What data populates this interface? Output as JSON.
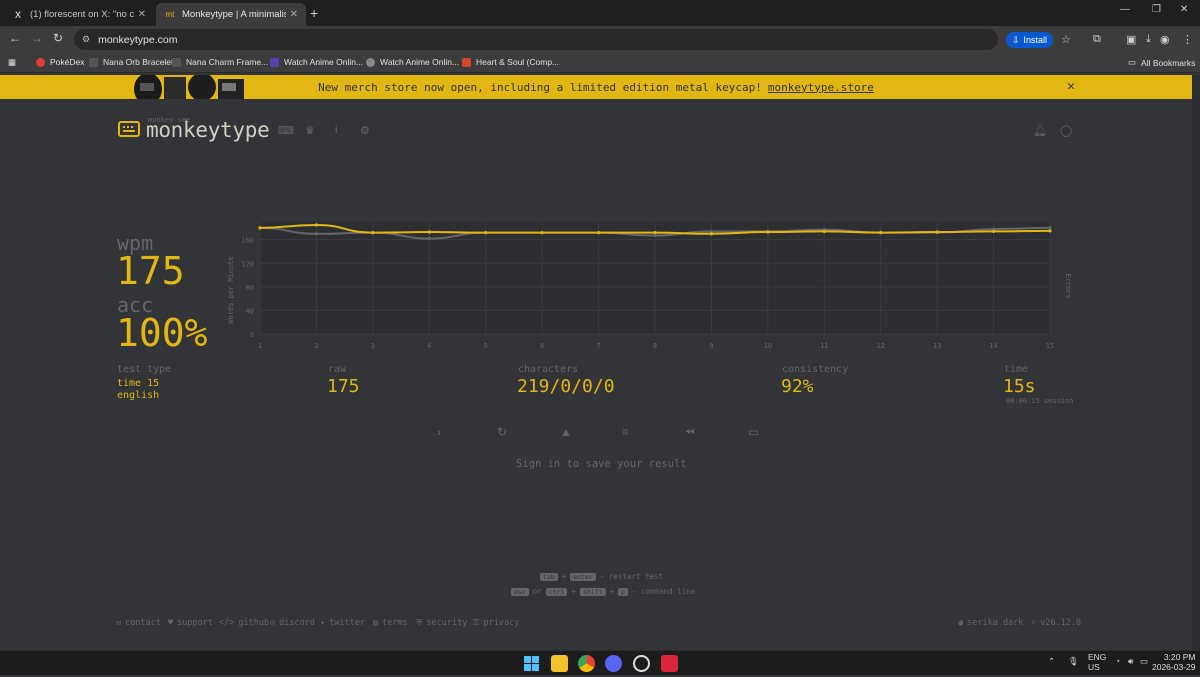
{
  "browser": {
    "tabs": [
      {
        "title": "(1) florescent on X: \"no caption",
        "favicon": "X"
      },
      {
        "title": "Monkeytype | A minimalistic, cu",
        "favicon": "mt"
      }
    ],
    "url": "monkeytype.com",
    "install_label": "Install",
    "bookmarks": [
      "PokéDex",
      "Nana Orb Bracelet",
      "Nana Charm Frame...",
      "Watch Anime Onlin...",
      "Watch Anime Onlin...",
      "Heart & Soul (Comp..."
    ],
    "all_bookmarks": "All Bookmarks"
  },
  "banner": {
    "text": "New merch store now open, including a limited edition metal keycap!",
    "link": "monkeytype.store",
    "close": "✕"
  },
  "header": {
    "logo_sub": "monkey see",
    "logo_text": "monkeytype"
  },
  "result": {
    "wpm_label": "wpm",
    "wpm": "175",
    "acc_label": "acc",
    "acc": "100%",
    "test_type_label": "test type",
    "test_type_mode": "time 15",
    "test_type_lang": "english",
    "raw_label": "raw",
    "raw": "175",
    "characters_label": "characters",
    "characters": "219/0/0/0",
    "consistency_label": "consistency",
    "consistency": "92%",
    "time_label": "time",
    "time": "15s",
    "session": "00:00:15 session"
  },
  "chart_data": {
    "type": "line",
    "x": [
      1,
      2,
      3,
      4,
      5,
      6,
      7,
      8,
      9,
      10,
      11,
      12,
      13,
      14,
      15
    ],
    "series": [
      {
        "name": "wpm",
        "color": "#e2b714",
        "values": [
          180,
          185,
          172,
          173,
          172,
          172,
          172,
          172,
          170,
          173,
          174,
          172,
          173,
          174,
          175
        ]
      },
      {
        "name": "raw",
        "color": "#646669",
        "values": [
          180,
          170,
          172,
          162,
          172,
          172,
          172,
          167,
          174,
          174,
          177,
          172,
          172,
          178,
          180
        ]
      }
    ],
    "ylabel": "Words per Minute",
    "y2label": "Errors",
    "yticks": [
      0,
      40,
      80,
      120,
      160
    ],
    "ylim": [
      0,
      190
    ]
  },
  "actions": {
    "hint": "Sign in to save your result"
  },
  "hints": {
    "restart_keys": [
      "tab",
      "enter"
    ],
    "restart_text": "- restart test",
    "cmd_keys": [
      "esc",
      "ctrl",
      "shift",
      "p"
    ],
    "or": "or",
    "cmd_text": "- command line"
  },
  "footer": {
    "links": [
      "contact",
      "support",
      "github",
      "discord",
      "twitter",
      "terms",
      "security",
      "privacy"
    ],
    "theme": "serika dark",
    "version": "v26.12.0"
  },
  "system": {
    "lang": "ENG",
    "region": "US",
    "time": "3:20 PM",
    "date": "2026-03-29"
  }
}
